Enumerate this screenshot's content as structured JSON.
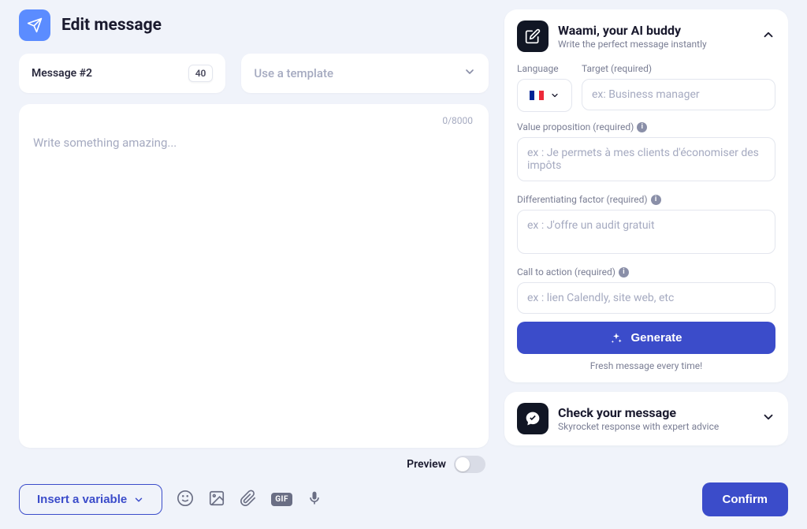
{
  "header": {
    "title": "Edit message"
  },
  "message": {
    "label": "Message #2",
    "badge": "40"
  },
  "template": {
    "placeholder": "Use a template"
  },
  "editor": {
    "placeholder": "Write something amazing...",
    "char_count": "0/8000"
  },
  "waami": {
    "title": "Waami, your AI buddy",
    "subtitle": "Write the perfect message instantly",
    "language_label": "Language",
    "target_label": "Target (required)",
    "target_placeholder": "ex: Business manager",
    "value_prop_label": "Value proposition (required)",
    "value_prop_placeholder": "ex : Je permets à mes clients d'économiser des impôts",
    "diff_label": "Differentiating factor (required)",
    "diff_placeholder": "ex : J'offre un audit gratuit",
    "cta_label": "Call to action (required)",
    "cta_placeholder": "ex : lien Calendly, site web, etc",
    "generate_label": "Generate",
    "fresh_note": "Fresh message every time!"
  },
  "check": {
    "title": "Check your message",
    "subtitle": "Skyrocket response with expert advice"
  },
  "preview": {
    "label": "Preview"
  },
  "toolbar": {
    "insert_variable": "Insert a variable"
  },
  "confirm": {
    "label": "Confirm"
  }
}
